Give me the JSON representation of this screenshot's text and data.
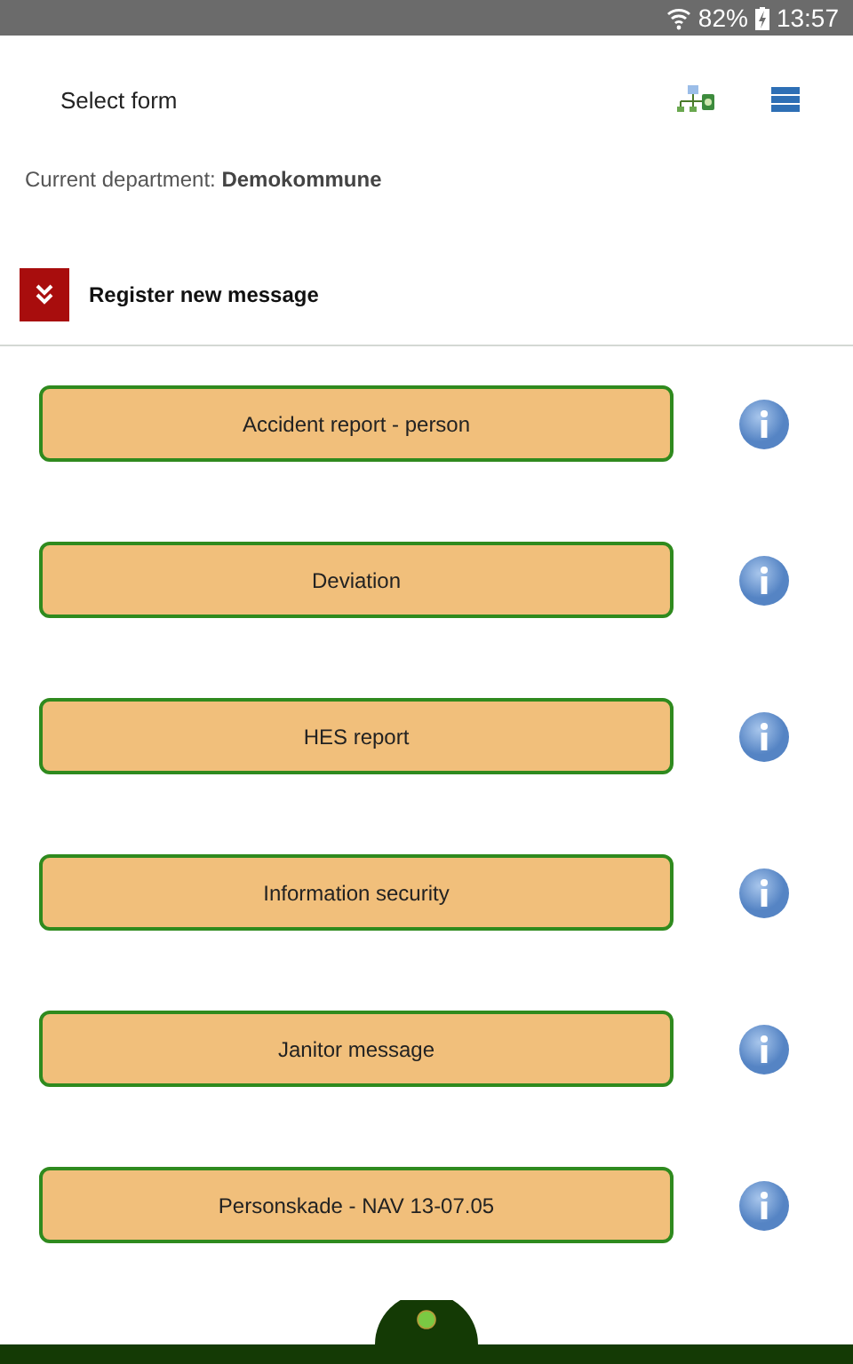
{
  "status_bar": {
    "battery": "82%",
    "time": "13:57"
  },
  "header": {
    "title": "Select form"
  },
  "department": {
    "label": "Current department: ",
    "value": "Demokommune"
  },
  "section": {
    "title": "Register new message",
    "expanded": true
  },
  "forms": [
    {
      "label": "Accident report - person"
    },
    {
      "label": "Deviation"
    },
    {
      "label": "HES report"
    },
    {
      "label": "Information security"
    },
    {
      "label": "Janitor message"
    },
    {
      "label": "Personskade - NAV 13-07.05"
    }
  ]
}
